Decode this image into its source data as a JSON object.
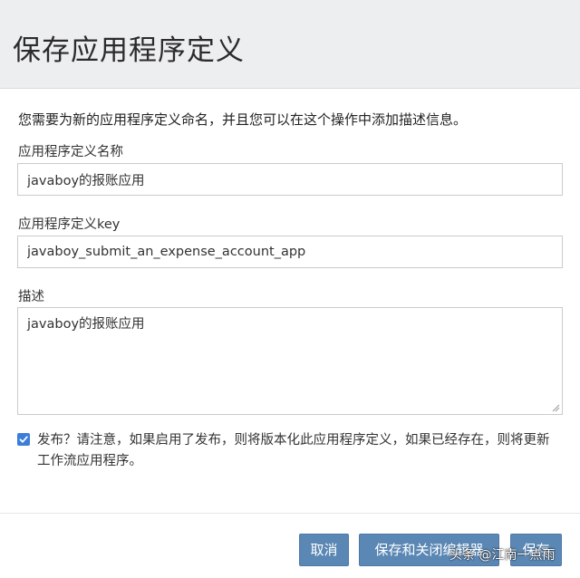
{
  "dialog": {
    "title": "保存应用程序定义",
    "intro": "您需要为新的应用程序定义命名，并且您可以在这个操作中添加描述信息。"
  },
  "form": {
    "name_label": "应用程序定义名称",
    "name_value": "javaboy的报账应用",
    "key_label": "应用程序定义key",
    "key_value": "javaboy_submit_an_expense_account_app",
    "description_label": "描述",
    "description_value": "javaboy的报账应用",
    "publish_checked": true,
    "publish_text": "发布？请注意，如果启用了发布，则将版本化此应用程序定义，如果已经存在，则将更新工作流应用程序。"
  },
  "footer": {
    "cancel_label": "取消",
    "save_close_label": "保存和关闭编辑器",
    "save_label": "保存"
  },
  "watermark": "头条 @江南一点雨",
  "colors": {
    "button": "#5b87b4",
    "checkbox": "#3b7dd8",
    "header_bg": "#eceef0"
  }
}
